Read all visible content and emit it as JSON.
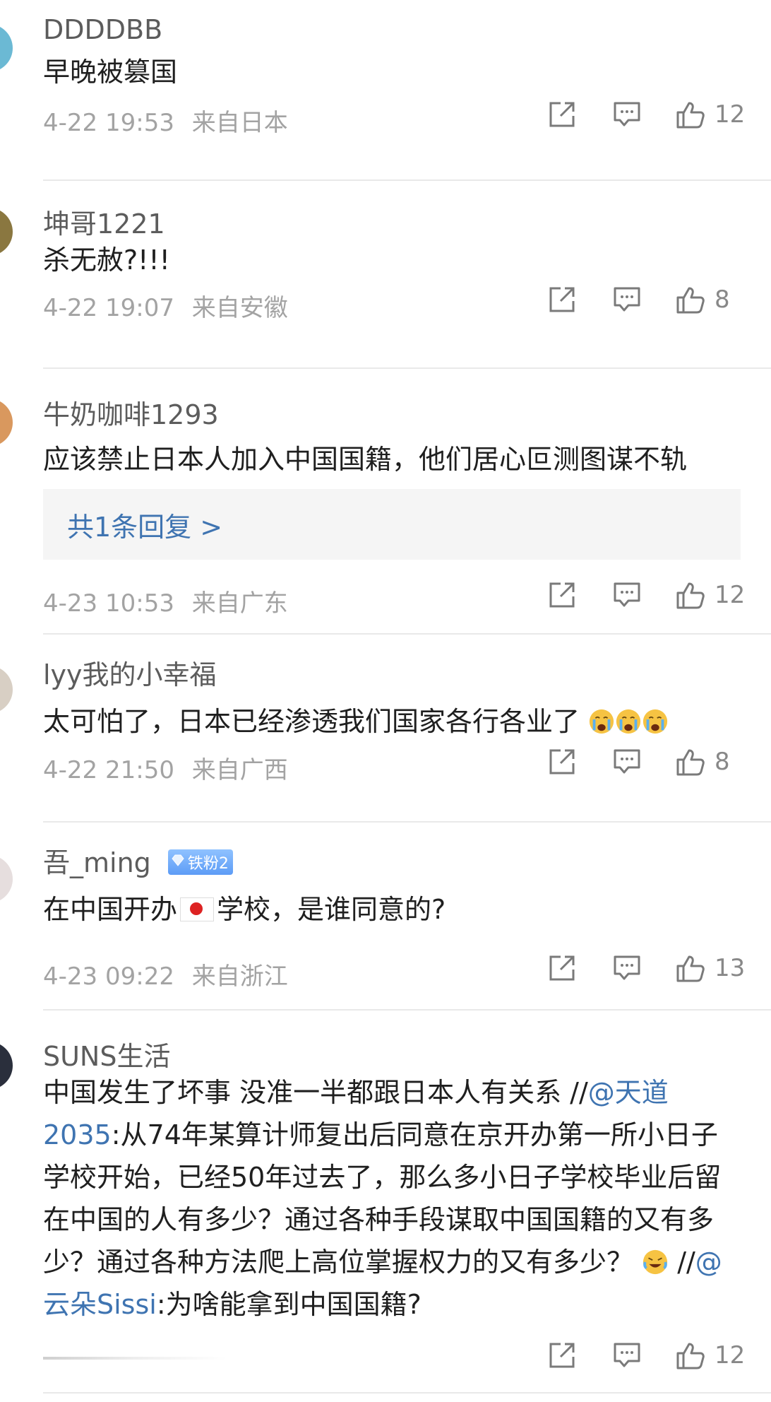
{
  "colors": {
    "accent": "#3f74b1",
    "meta": "#a3a3a3",
    "divider": "#e9e9e9"
  },
  "comments": [
    {
      "username": "DDDDBB",
      "text": "早晚被篡国",
      "time": "4-22 19:53",
      "location": "来自日本",
      "likes": "12",
      "avatar_color": "#6bb9d4"
    },
    {
      "username": "坤哥1221",
      "text": "杀无赦?!!!",
      "time": "4-22 19:07",
      "location": "来自安徽",
      "likes": "8",
      "avatar_color": "#8a7740"
    },
    {
      "username": "牛奶咖啡1293",
      "text": "应该禁止日本人加入中国国籍，他们居心叵测图谋不轨",
      "reply_label": "共1条回复 >",
      "time": "4-23 10:53",
      "location": "来自广东",
      "likes": "12",
      "avatar_color": "#d9985e"
    },
    {
      "username": "lyy我的小幸福",
      "text": "太可怕了，日本已经渗透我们国家各行各业了",
      "time": "4-22 21:50",
      "location": "来自广西",
      "likes": "8",
      "avatar_color": "#d8cfc4"
    },
    {
      "username": "吾_ming",
      "badge": "铁粉2",
      "text_before_flag": "在中国开办",
      "text_after_flag": "学校，是谁同意的?",
      "time": "4-23 09:22",
      "location": "来自浙江",
      "likes": "13",
      "avatar_color": "#e6dede"
    },
    {
      "username": "SUNS生活",
      "text_parts": {
        "p1": "中国发生了坏事 没准一半都跟日本人有关系 //",
        "m1": "@天道2035",
        "p2": ":从74年某算计师复出后同意在京开办第一所小日子学校开始，已经50年过去了，那么多小日子学校毕业后留在中国的人有多少？通过各种手段谋取中国国籍的又有多少？通过各种方法爬上高位掌握权力的又有多少？",
        "p3": " //",
        "m2": "@云朵Sissi",
        "p4": ":为啥能拿到中国国籍?"
      },
      "likes": "12",
      "avatar_color": "#2a2f3c"
    }
  ]
}
